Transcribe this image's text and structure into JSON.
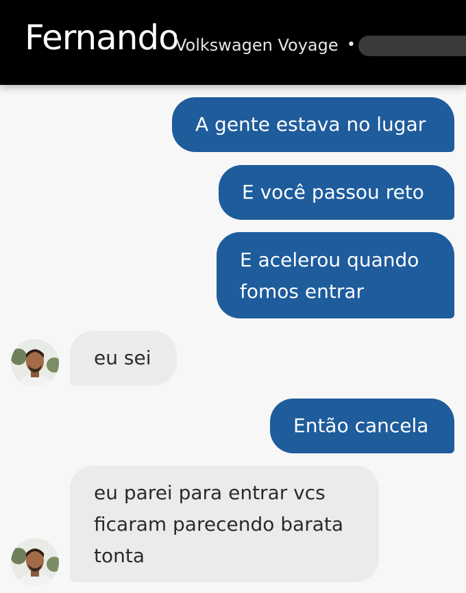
{
  "header": {
    "driver_name": "Fernando",
    "vehicle": "Volkswagen Voyage",
    "separator": "•"
  },
  "messages": [
    {
      "direction": "out",
      "lines": [
        "A gente estava no lugar"
      ]
    },
    {
      "direction": "out",
      "lines": [
        "E você passou reto"
      ]
    },
    {
      "direction": "out",
      "lines": [
        "E acelerou quando",
        "fomos entrar"
      ]
    },
    {
      "direction": "in",
      "lines": [
        "eu sei"
      ]
    },
    {
      "direction": "out",
      "lines": [
        "Então cancela"
      ]
    },
    {
      "direction": "in",
      "lines": [
        "eu parei para entrar vcs",
        "ficaram parecendo barata",
        "tonta"
      ]
    }
  ],
  "colors": {
    "outgoing_bubble": "#1e5c9c",
    "incoming_bubble": "#ebebeb",
    "header_background": "#000000"
  }
}
